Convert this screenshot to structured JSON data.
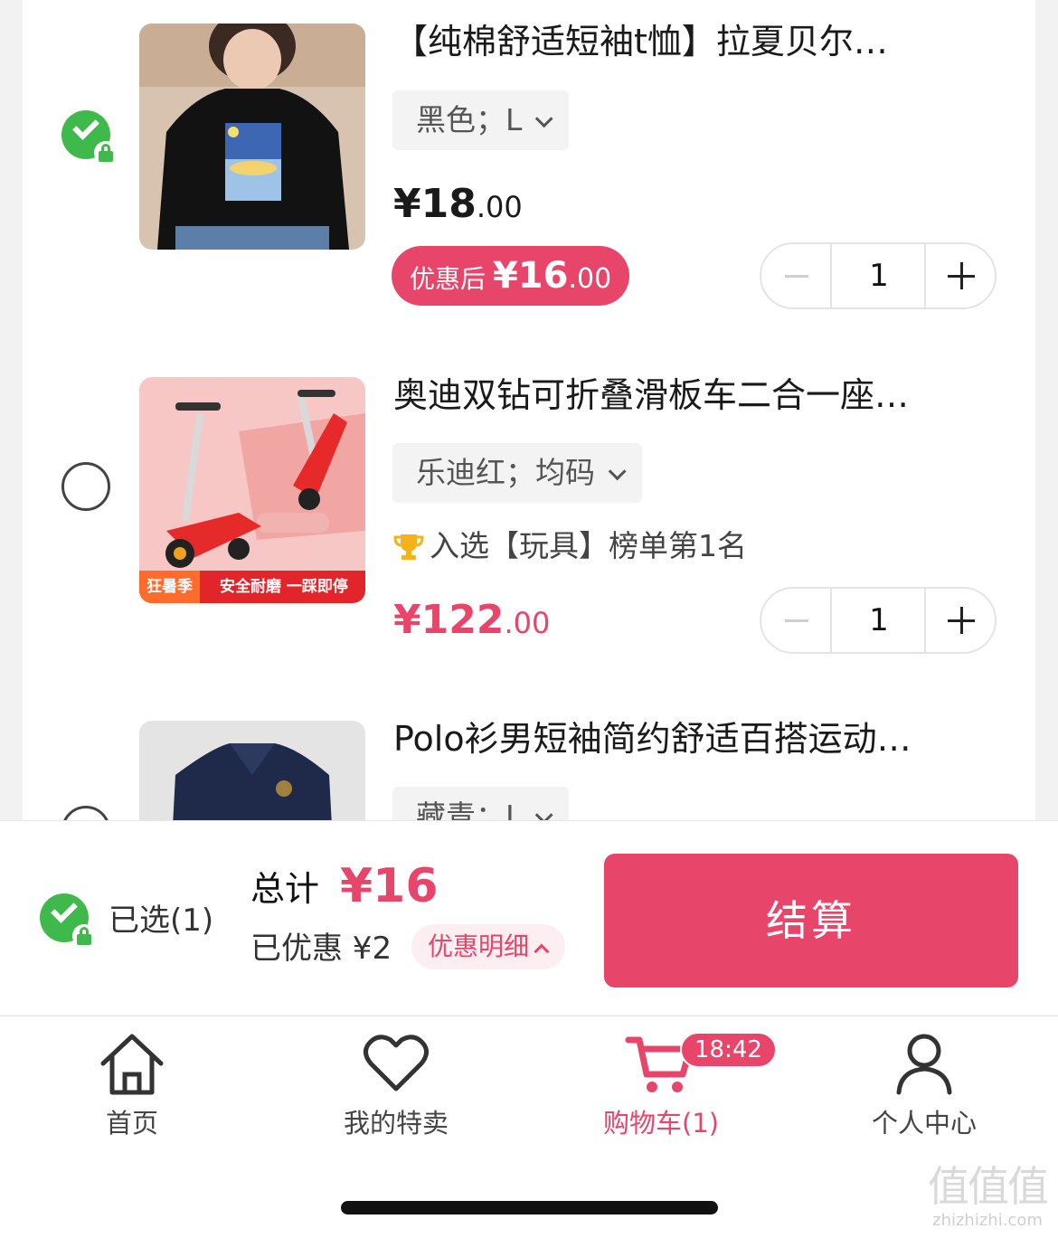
{
  "cart": {
    "items": [
      {
        "title": "【纯棉舒适短袖t恤】拉夏贝尔…",
        "spec": "黑色；L",
        "price_int": "¥18",
        "price_dec": ".00",
        "coupon_label": "优惠后",
        "coupon_int": "¥16",
        "coupon_dec": ".00",
        "quantity": "1",
        "selected": true
      },
      {
        "title": "奥迪双钻可折叠滑板车二合一座…",
        "spec": "乐迪红；均码",
        "rank": "入选【玩具】榜单第1名",
        "thumb_tag": "狂暑季",
        "thumb_slogan": "安全耐磨 一踩即停",
        "price_int": "¥122",
        "price_dec": ".00",
        "quantity": "1",
        "selected": false
      },
      {
        "title": "Polo衫男短袖简约舒适百搭运动…",
        "spec": "藏青；L",
        "selected": false
      }
    ]
  },
  "checkout": {
    "selected_label": "已选(1)",
    "total_label": "总计",
    "total_value": "¥16",
    "discount_text": "已优惠 ¥2",
    "detail_label": "优惠明细",
    "pay_label": "结算"
  },
  "tabbar": {
    "tabs": [
      {
        "label": "首页",
        "icon": "home-icon"
      },
      {
        "label": "我的特卖",
        "icon": "heart-icon"
      },
      {
        "label": "购物车(1)",
        "icon": "cart-icon",
        "active": true
      },
      {
        "label": "个人中心",
        "icon": "user-icon"
      }
    ],
    "cart_badge": "18:42"
  },
  "watermark": {
    "glyphs": "值值值",
    "url": "zhizhizhi.com"
  },
  "colors": {
    "accent": "#e8456a",
    "check_green": "#3fb94b"
  }
}
